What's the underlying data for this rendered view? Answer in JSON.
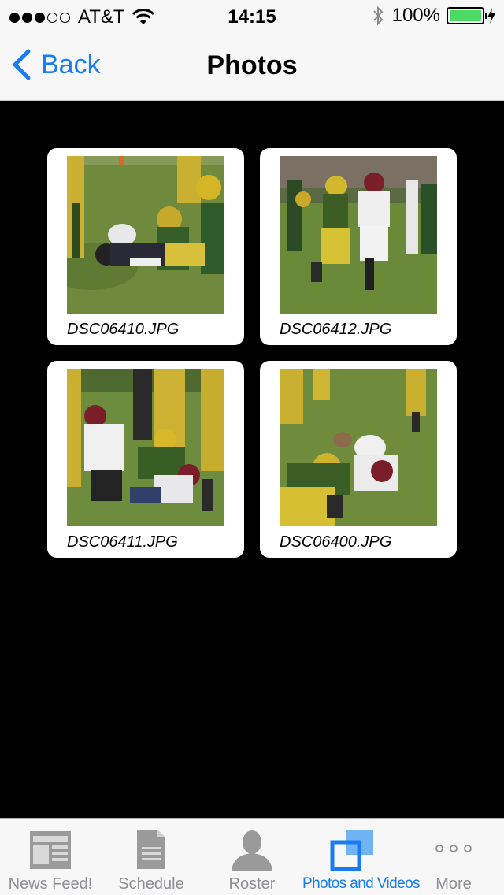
{
  "status_bar": {
    "carrier": "AT&T",
    "signal_bars_filled": 3,
    "signal_bars_total": 5,
    "time": "14:15",
    "battery_percent": "100%",
    "battery_level": 1.0,
    "battery_color": "#4cd964"
  },
  "nav": {
    "back_label": "Back",
    "title": "Photos"
  },
  "photos": [
    {
      "filename": "DSC06410.JPG"
    },
    {
      "filename": "DSC06412.JPG"
    },
    {
      "filename": "DSC06411.JPG"
    },
    {
      "filename": "DSC06400.JPG"
    }
  ],
  "tabs": [
    {
      "label": "News Feed!",
      "icon": "newspaper-icon",
      "active": false
    },
    {
      "label": "Schedule",
      "icon": "document-icon",
      "active": false
    },
    {
      "label": "Roster",
      "icon": "person-icon",
      "active": false
    },
    {
      "label": "Photos and Videos",
      "icon": "photos-icon",
      "active": true
    },
    {
      "label": "More",
      "icon": "more-dots-icon",
      "active": false
    }
  ],
  "colors": {
    "accent": "#1a7cf2",
    "inactive_tab": "#8e8e93",
    "background": "#000000"
  }
}
